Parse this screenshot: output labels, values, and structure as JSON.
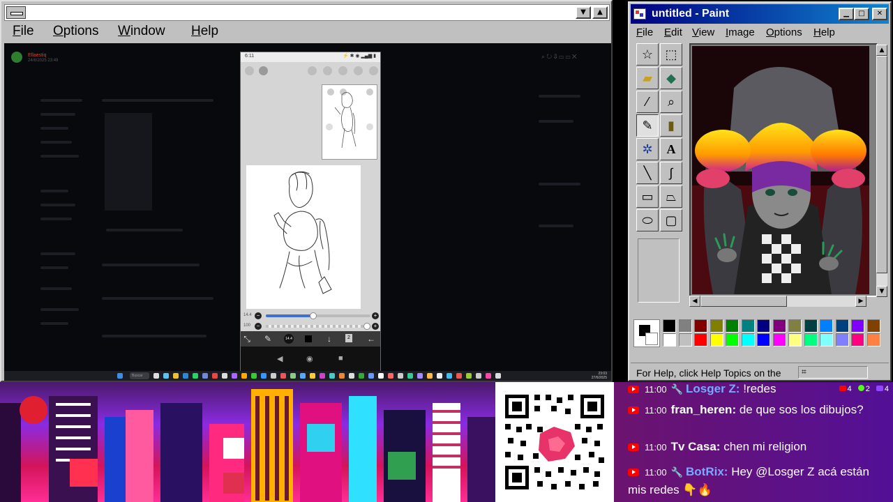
{
  "left_window": {
    "menu": [
      "File",
      "Options",
      "Window",
      "Help"
    ],
    "title_controls": [
      "▼",
      "▲"
    ],
    "app_user": "Ellaestiq",
    "app_date": "24/6/2025 23:49",
    "phone": {
      "time": "6:11",
      "size_value": "14.4",
      "layer_count": "2"
    },
    "taskbar": {
      "search_label": "Buscar",
      "clock_time": "23:03",
      "clock_date": "27/6/2025"
    }
  },
  "paint": {
    "title": "untitled - Paint",
    "menu": [
      "File",
      "Edit",
      "View",
      "Image",
      "Options",
      "Help"
    ],
    "status_text": "For Help, click Help Topics on the",
    "palette_top": [
      "#000000",
      "#808080",
      "#800000",
      "#808000",
      "#008000",
      "#008080",
      "#000080",
      "#800080",
      "#808040",
      "#004040",
      "#0080ff",
      "#004080",
      "#8000ff",
      "#804000"
    ],
    "palette_bottom": [
      "#ffffff",
      "#c0c0c0",
      "#ff0000",
      "#ffff00",
      "#00ff00",
      "#00ffff",
      "#0000ff",
      "#ff00ff",
      "#ffff80",
      "#00ff80",
      "#80ffff",
      "#8080ff",
      "#ff0080",
      "#ff8040"
    ],
    "tools": [
      "free-select",
      "rect-select",
      "eraser",
      "fill",
      "picker",
      "magnifier",
      "pencil",
      "brush",
      "airbrush",
      "text",
      "line",
      "curve",
      "rectangle",
      "polygon",
      "ellipse",
      "rounded-rect"
    ]
  },
  "chat": {
    "counts": [
      {
        "platform": "youtube",
        "count": "4",
        "color": "#ff0000"
      },
      {
        "platform": "kick",
        "count": "2",
        "color": "#53fc18"
      },
      {
        "platform": "twitch",
        "count": "4",
        "color": "#9146ff"
      }
    ],
    "messages": [
      {
        "time": "11:00",
        "user": "Losger Z:",
        "text": "!redes",
        "bot": true
      },
      {
        "time": "11:00",
        "user": "fran_heren:",
        "text": "de que sos los dibujos?",
        "bot": false
      },
      {
        "time": "11:00",
        "user": "Tv Casa:",
        "text": "chen mi religion",
        "bot": false
      },
      {
        "time": "11:00",
        "user": "BotRix:",
        "text": "Hey @Losger Z acá están mis redes 👇🔥",
        "bot": true
      }
    ]
  }
}
